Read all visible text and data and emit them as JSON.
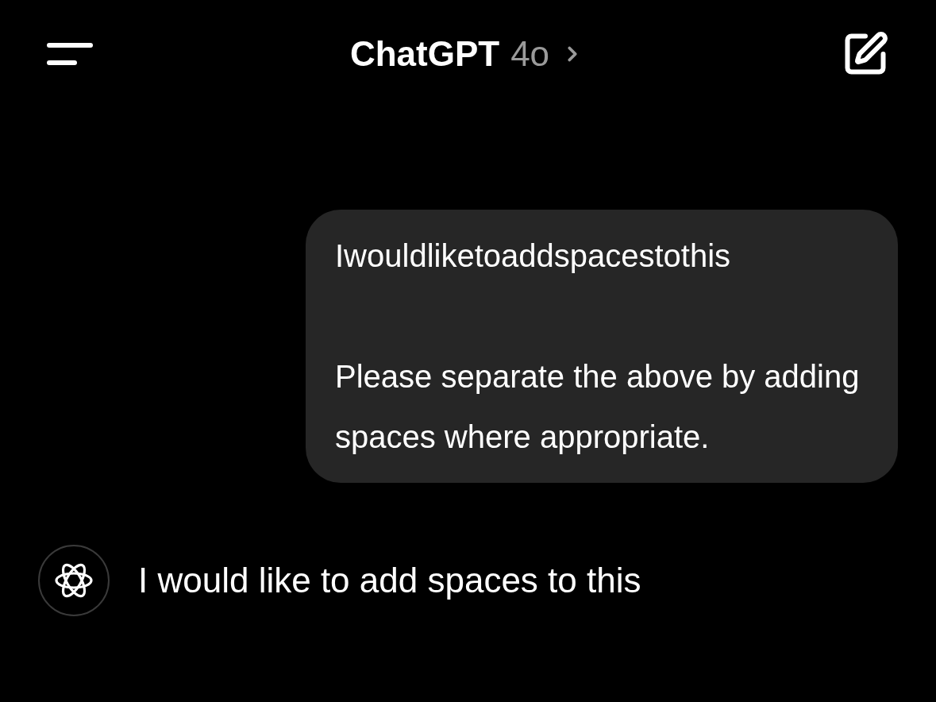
{
  "header": {
    "title": "ChatGPT",
    "model": "4o"
  },
  "messages": [
    {
      "kind": "user",
      "paragraphs": [
        "Iwouldliketoaddspacestothis",
        "Please separate the above by adding spaces where appropriate."
      ]
    },
    {
      "kind": "assistant",
      "paragraphs": [
        "I would like to add spaces to this"
      ]
    }
  ]
}
